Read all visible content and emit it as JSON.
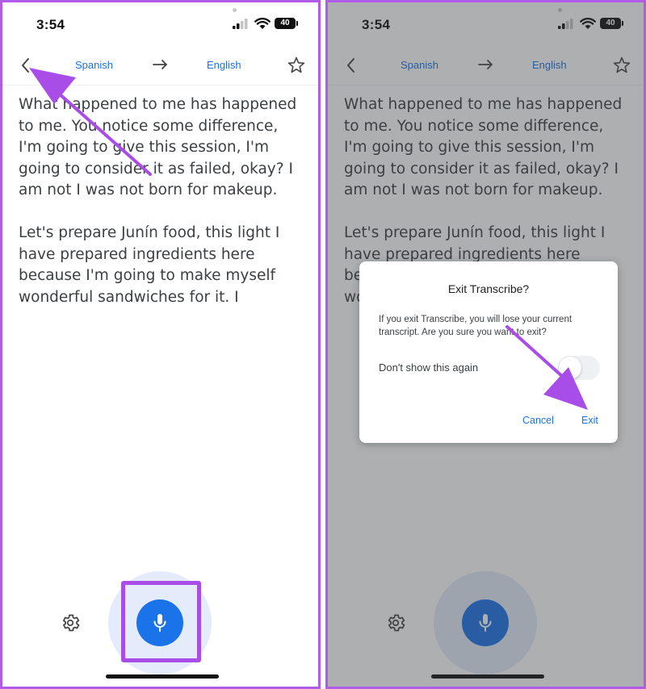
{
  "status_bar": {
    "time": "3:54",
    "battery": "40"
  },
  "header": {
    "source_language": "Spanish",
    "target_language": "English"
  },
  "transcript": {
    "paragraphs": [
      "What happened to me has happened to me. You notice some difference, I'm going to give this session, I'm going to consider it as failed, okay? I am not I was not born for makeup.",
      "Let's prepare Junín food, this light I have prepared ingredients here because I'm going to make myself wonderful sandwiches for it. I"
    ]
  },
  "dialog": {
    "title": "Exit Transcribe?",
    "message": "If you exit Transcribe, you will lose your current transcript. Are you sure you want to exit?",
    "dont_show_label": "Don't show this again",
    "cancel_label": "Cancel",
    "exit_label": "Exit"
  },
  "icons": {
    "back": "back-arrow-icon",
    "swap": "arrow-right-icon",
    "star": "star-icon",
    "settings": "gear-icon",
    "mic": "microphone-icon"
  },
  "colors": {
    "accent": "#1a73e8",
    "annotation": "#a94de8",
    "overlay": "#3c4043"
  }
}
